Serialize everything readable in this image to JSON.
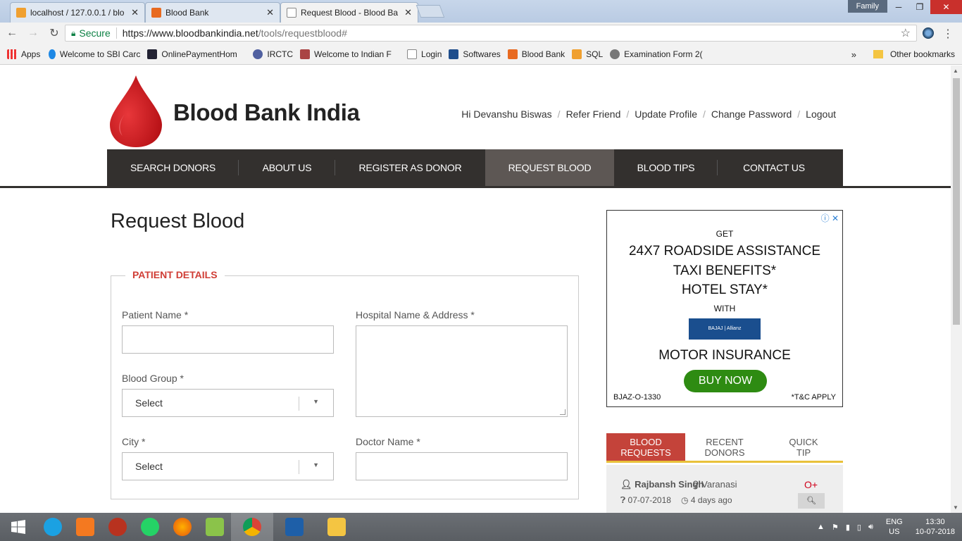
{
  "browser": {
    "tabs": [
      {
        "title": "localhost / 127.0.0.1 / blo",
        "active": false
      },
      {
        "title": "Blood Bank",
        "active": false
      },
      {
        "title": "Request Blood - Blood Ba",
        "active": true
      }
    ],
    "family_label": "Family",
    "secure_label": "Secure",
    "url_host": "https://www.bloodbankindia.net",
    "url_path": "/tools/requestblood#",
    "bookmarks": [
      {
        "label": "Apps",
        "icon": "apps-grid-icon"
      },
      {
        "label": "Welcome to SBI Carc",
        "icon": "sbi-icon"
      },
      {
        "label": "OnlinePaymentHom",
        "icon": "payment-icon"
      },
      {
        "label": "IRCTC",
        "icon": "irctc-icon"
      },
      {
        "label": "Welcome to Indian F",
        "icon": "indian-icon"
      },
      {
        "label": "Login",
        "icon": "page-icon"
      },
      {
        "label": "Softwares",
        "icon": "a-icon"
      },
      {
        "label": "Blood Bank",
        "icon": "xampp-icon"
      },
      {
        "label": "SQL",
        "icon": "pma-icon"
      },
      {
        "label": "Examination Form 2(",
        "icon": "exam-icon"
      }
    ],
    "bookmarks_more": "»",
    "other_bookmarks": "Other bookmarks"
  },
  "site": {
    "logo_text": "Blood Bank India",
    "user_links": [
      "Hi Devanshu Biswas",
      "Refer Friend",
      "Update Profile",
      "Change Password",
      "Logout"
    ],
    "nav": [
      {
        "label": "SEARCH DONORS",
        "active": false
      },
      {
        "label": "ABOUT US",
        "active": false
      },
      {
        "label": "REGISTER AS DONOR",
        "active": false
      },
      {
        "label": "REQUEST BLOOD",
        "active": true
      },
      {
        "label": "BLOOD TIPS",
        "active": false
      },
      {
        "label": "CONTACT US",
        "active": false
      }
    ],
    "page_title": "Request Blood",
    "form": {
      "legend": "PATIENT DETAILS",
      "patient_name_label": "Patient Name *",
      "hospital_label": "Hospital Name & Address *",
      "blood_group_label": "Blood Group *",
      "blood_group_value": "Select",
      "city_label": "City *",
      "city_value": "Select",
      "doctor_label": "Doctor Name *"
    },
    "ad": {
      "get": "GET",
      "line1": "24X7 ROADSIDE ASSISTANCE",
      "line2": "TAXI BENEFITS*",
      "line3": "HOTEL STAY*",
      "with": "WITH",
      "brand": "BAJAJ | Allianz",
      "product": "MOTOR INSURANCE",
      "cta": "BUY NOW",
      "code": "BJAZ-O-1330",
      "tc": "*T&C APPLY"
    },
    "widget": {
      "tabs": [
        {
          "label": "BLOOD REQUESTS",
          "active": true
        },
        {
          "label": "RECENT DONORS",
          "active": false
        },
        {
          "label": "QUICK TIP",
          "active": false
        }
      ],
      "request": {
        "name": "Rajbansh Singh",
        "city": "Varanasi",
        "group": "O+",
        "date": "07-07-2018",
        "ago": "4 days ago"
      }
    }
  },
  "taskbar": {
    "lang": "ENG",
    "region": "US",
    "time": "13:30",
    "date": "10-07-2018"
  }
}
